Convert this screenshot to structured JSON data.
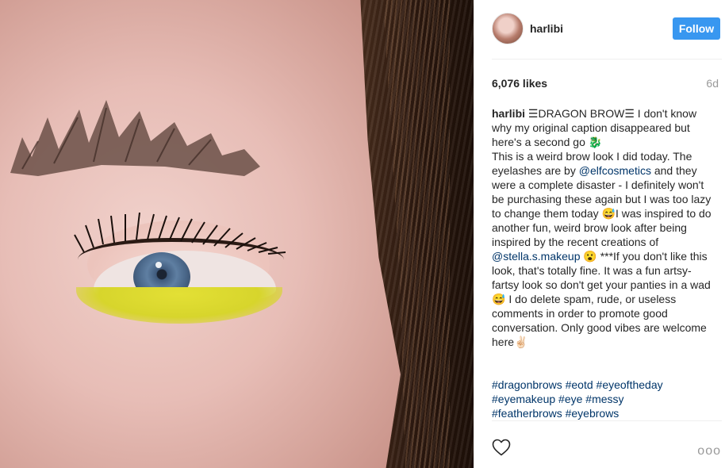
{
  "post": {
    "username": "harlibi",
    "follow_label": "Follow",
    "likes": "6,076 likes",
    "time_ago": "6d",
    "caption": {
      "username": "harlibi",
      "part1": " ☰DRAGON BROW☰ I don't know why my original caption disappeared but here's a second go 🐉\nThis is a weird brow look I did today. The eyelashes are by ",
      "mention1": "@elfcosmetics",
      "part2": " and they were a complete disaster - I definitely won't be purchasing these again but I was too lazy to change them today 😅I was inspired to do another fun, weird brow look after being inspired by the recent creations of ",
      "mention2": "@stella.s.makeup",
      "part3": " 😮 ***If you don't like this look, that's totally fine. It was a fun artsy-fartsy look so don't get your panties in a wad 😅 I do delete spam, rude, or useless comments in order to promote good conversation. Only good vibes are welcome here✌🏻"
    },
    "hashtags": "#dragonbrows #eotd #eyeoftheday\n#eyemakeup #eye #messy\n#featherbrows #eyebrows",
    "more_label": "ooo"
  },
  "icons": {
    "heart": "heart-icon",
    "more": "more-options-icon"
  },
  "colors": {
    "follow_button": "#3897f0",
    "link": "#003569",
    "muted": "#999999"
  }
}
